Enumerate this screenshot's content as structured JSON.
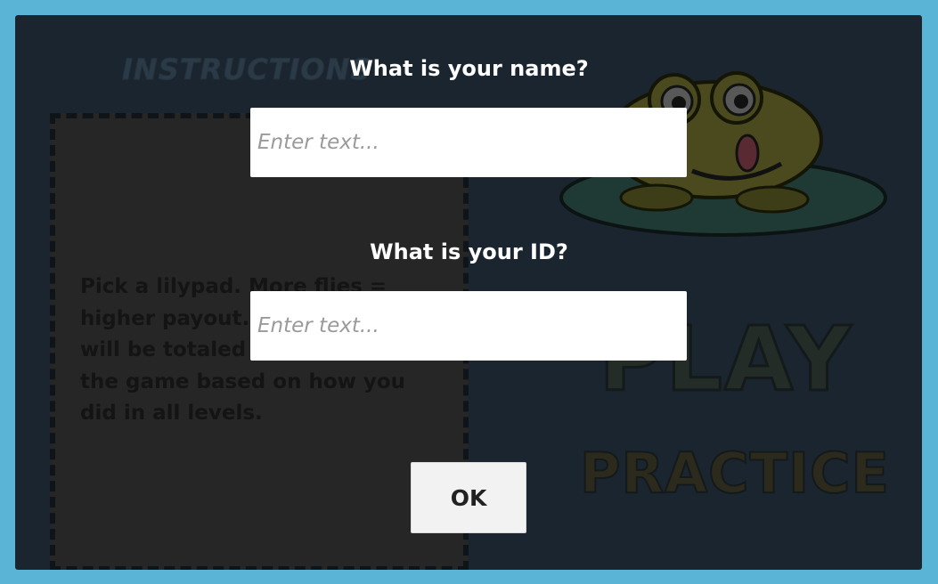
{
  "background_game": {
    "instructions_title": "INSTRUCTIONS",
    "instructions_body": "Pick a lilypad. More flies = higher payout. Your payout will be totaled at the end of the game based on how you did in all levels.",
    "play_label": "PLAY",
    "practice_label": "PRACTICE"
  },
  "dialog": {
    "name_question": "What is your name?",
    "name_placeholder": "Enter text...",
    "id_question": "What is your ID?",
    "id_placeholder": "Enter text...",
    "ok_label": "OK"
  },
  "colors": {
    "page_background": "#5ab4d6",
    "panel_background": "#1a2530",
    "input_background": "#ffffff",
    "button_background": "#f2f2f2"
  }
}
